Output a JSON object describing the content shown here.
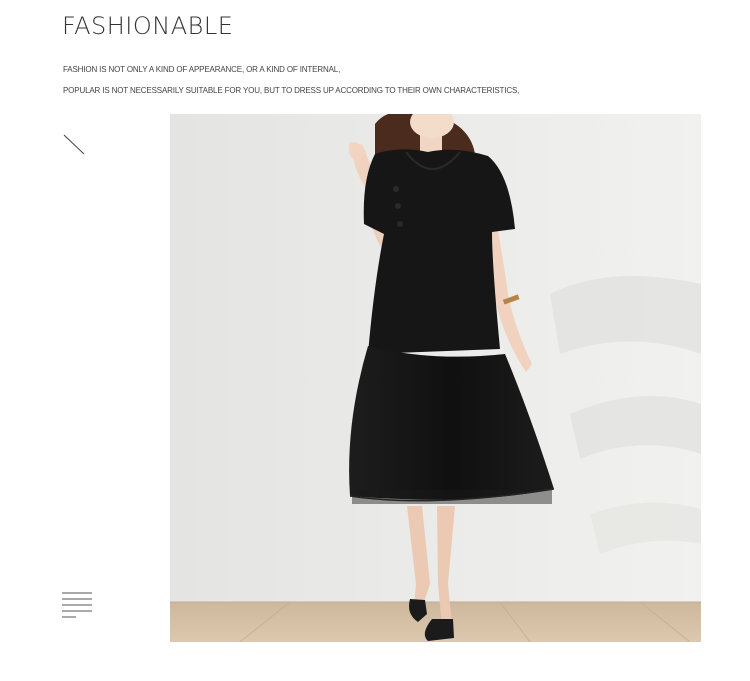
{
  "header": {
    "title": "FASHIONABLE",
    "line1": "FASHION IS NOT ONLY A KIND OF APPEARANCE, OR A KIND OF INTERNAL,",
    "line2": "POPULAR IS NOT NECESSARILY SUITABLE FOR YOU, BUT TO DRESS UP ACCORDING TO THEIR OWN CHARACTERISTICS,"
  },
  "decor": {
    "top_icon": "diagonal-line-icon",
    "bottom_icon": "menu-lines-icon"
  },
  "photo": {
    "subject": "model-in-black-dress",
    "dress_color": "#151515",
    "wall_color": "#e9e9e7",
    "floor_color": "#d6c3a9"
  }
}
